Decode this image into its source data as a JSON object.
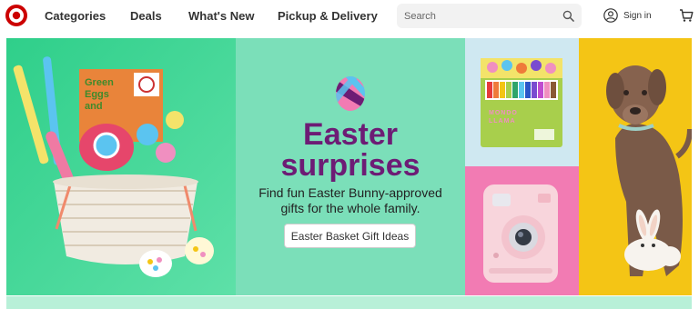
{
  "header": {
    "nav": [
      "Categories",
      "Deals",
      "What's New",
      "Pickup & Delivery"
    ],
    "search_placeholder": "Search",
    "signin_label": "Sign in"
  },
  "hero": {
    "headline_line1": "Easter",
    "headline_line2": "surprises",
    "subtext_line1": "Find fun Easter Bunny-approved",
    "subtext_line2": "gifts for the whole family.",
    "cta_label": "Easter Basket Gift Ideas",
    "book_title": [
      "Green",
      "Eggs",
      "and"
    ],
    "crayon_box_label": [
      "MONDO",
      "LLAMA"
    ]
  },
  "colors": {
    "brand_red": "#cc0000",
    "headline_purple": "#6d1c75",
    "mid_panel_green": "#7bdfb9",
    "left_panel_green": "#3dd396",
    "dog_panel_yellow": "#f4c515",
    "camera_panel_pink": "#f27bb3",
    "crayon_panel_blue": "#cfe8f1"
  },
  "icons": [
    "target-logo-icon",
    "search-icon",
    "account-icon",
    "cart-icon",
    "easter-egg-icon"
  ]
}
